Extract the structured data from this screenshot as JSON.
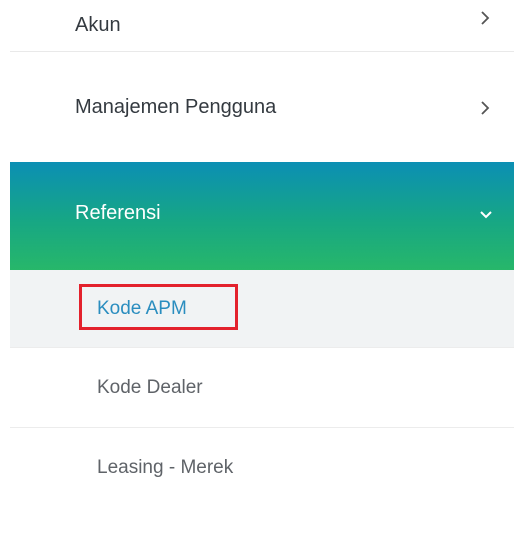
{
  "menu": {
    "items": [
      {
        "label": "Akun",
        "chevron": "chevron-right-icon"
      },
      {
        "label": "Manajemen Pengguna",
        "chevron": "chevron-right-icon"
      },
      {
        "label": "Referensi",
        "chevron": "chevron-down-icon"
      }
    ],
    "submenu": [
      {
        "label": "Kode APM"
      },
      {
        "label": "Kode Dealer"
      },
      {
        "label": "Leasing - Merek"
      }
    ]
  },
  "colors": {
    "active_gradient_top": "#0b8fb4",
    "active_gradient_bottom": "#27b76a",
    "submenu_active_text": "#2a8dbf",
    "highlight_border": "#e3212c"
  }
}
